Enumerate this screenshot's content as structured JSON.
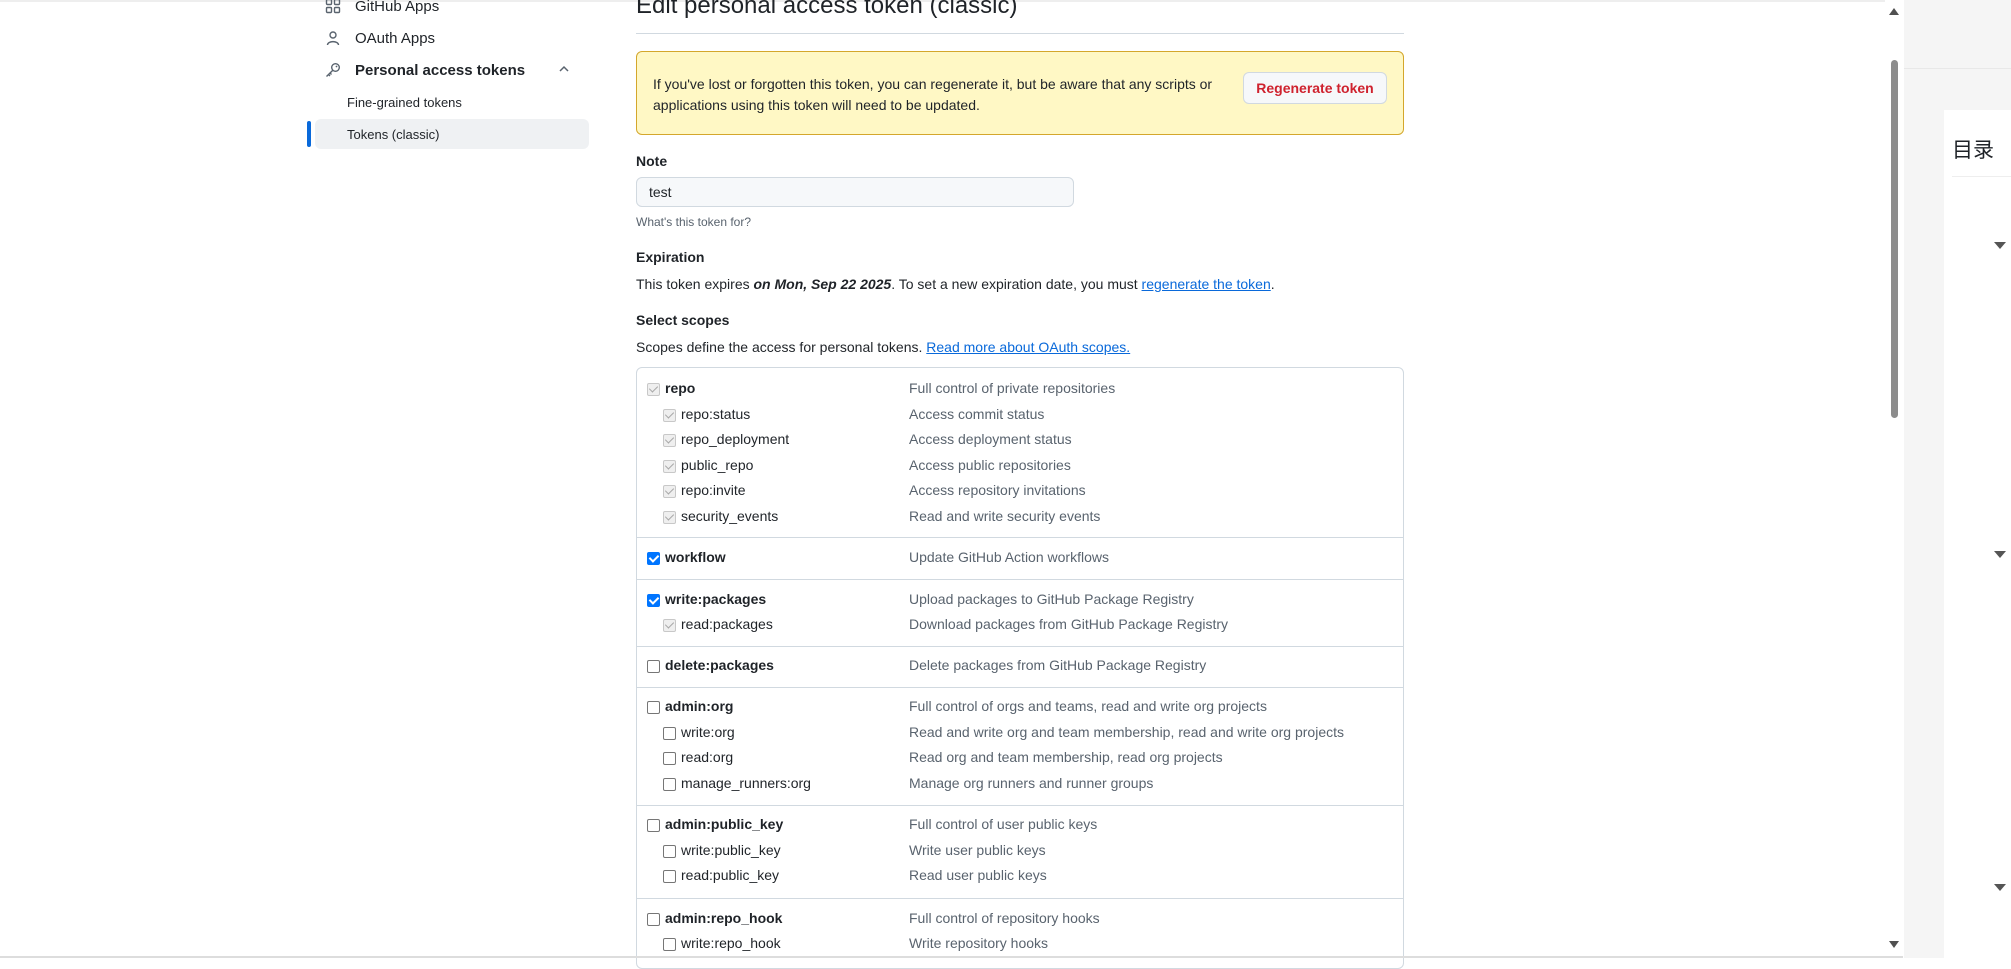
{
  "sidebar": {
    "github_apps": "GitHub Apps",
    "oauth_apps": "OAuth Apps",
    "personal_access_tokens": "Personal access tokens",
    "fine_grained": "Fine-grained tokens",
    "tokens_classic": "Tokens (classic)"
  },
  "page": {
    "title": "Edit personal access token (classic)"
  },
  "flash": {
    "message": "If you've lost or forgotten this token, you can regenerate it, but be aware that any scripts or applications using this token will need to be updated.",
    "button": "Regenerate token"
  },
  "note": {
    "label": "Note",
    "value": "test",
    "hint": "What's this token for?"
  },
  "expiration": {
    "label": "Expiration",
    "prefix": "This token expires ",
    "date": "on Mon, Sep 22 2025",
    "middle": ". To set a new expiration date, you must ",
    "link": "regenerate the token",
    "suffix": "."
  },
  "scopes_header": {
    "label": "Select scopes",
    "text": "Scopes define the access for personal tokens. ",
    "link": "Read more about OAuth scopes."
  },
  "scopes": {
    "repo": {
      "name": "repo",
      "desc": "Full control of private repositories",
      "state": "disabled"
    },
    "repo_status": {
      "name": "repo:status",
      "desc": "Access commit status",
      "state": "disabled"
    },
    "repo_deployment": {
      "name": "repo_deployment",
      "desc": "Access deployment status",
      "state": "disabled"
    },
    "public_repo": {
      "name": "public_repo",
      "desc": "Access public repositories",
      "state": "disabled"
    },
    "repo_invite": {
      "name": "repo:invite",
      "desc": "Access repository invitations",
      "state": "disabled"
    },
    "security_events": {
      "name": "security_events",
      "desc": "Read and write security events",
      "state": "disabled"
    },
    "workflow": {
      "name": "workflow",
      "desc": "Update GitHub Action workflows",
      "state": "checked"
    },
    "write_packages": {
      "name": "write:packages",
      "desc": "Upload packages to GitHub Package Registry",
      "state": "checked"
    },
    "read_packages": {
      "name": "read:packages",
      "desc": "Download packages from GitHub Package Registry",
      "state": "disabled"
    },
    "delete_packages": {
      "name": "delete:packages",
      "desc": "Delete packages from GitHub Package Registry",
      "state": "unchecked"
    },
    "admin_org": {
      "name": "admin:org",
      "desc": "Full control of orgs and teams, read and write org projects",
      "state": "unchecked"
    },
    "write_org": {
      "name": "write:org",
      "desc": "Read and write org and team membership, read and write org projects",
      "state": "unchecked"
    },
    "read_org": {
      "name": "read:org",
      "desc": "Read org and team membership, read org projects",
      "state": "unchecked"
    },
    "manage_runners_org": {
      "name": "manage_runners:org",
      "desc": "Manage org runners and runner groups",
      "state": "unchecked"
    },
    "admin_public_key": {
      "name": "admin:public_key",
      "desc": "Full control of user public keys",
      "state": "unchecked"
    },
    "write_public_key": {
      "name": "write:public_key",
      "desc": "Write user public keys",
      "state": "unchecked"
    },
    "read_public_key": {
      "name": "read:public_key",
      "desc": "Read user public keys",
      "state": "unchecked"
    },
    "admin_repo_hook": {
      "name": "admin:repo_hook",
      "desc": "Full control of repository hooks",
      "state": "unchecked"
    },
    "write_repo_hook": {
      "name": "write:repo_hook",
      "desc": "Write repository hooks",
      "state": "unchecked"
    }
  },
  "right_panel": {
    "toc_title": "目录"
  }
}
